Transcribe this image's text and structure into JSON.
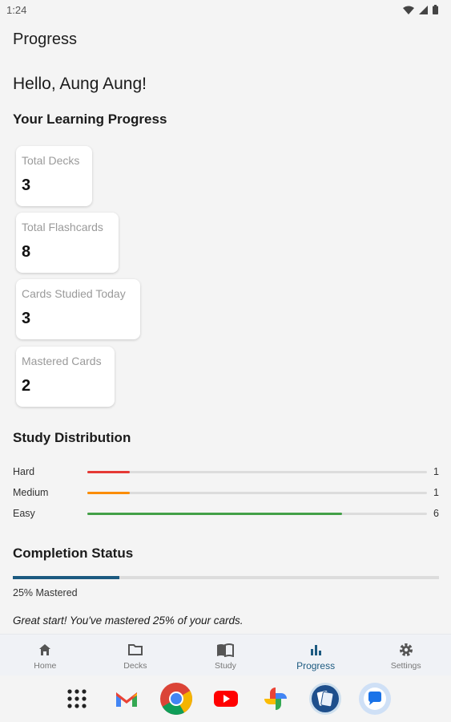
{
  "status_bar": {
    "time": "1:24",
    "icons": [
      "wifi-icon",
      "signal-icon",
      "battery-icon"
    ]
  },
  "app_bar": {
    "title": "Progress"
  },
  "greeting": "Hello, Aung Aung!",
  "learning_progress": {
    "title": "Your Learning Progress",
    "stats": [
      {
        "label": "Total Decks",
        "value": "3"
      },
      {
        "label": "Total Flashcards",
        "value": "8"
      },
      {
        "label": "Cards Studied Today",
        "value": "3"
      },
      {
        "label": "Mastered Cards",
        "value": "2"
      }
    ]
  },
  "study_distribution": {
    "title": "Study Distribution",
    "rows": [
      {
        "label": "Hard",
        "count": "1",
        "fraction": 0.125,
        "color": "#e53935"
      },
      {
        "label": "Medium",
        "count": "1",
        "fraction": 0.125,
        "color": "#fb8c00"
      },
      {
        "label": "Easy",
        "count": "6",
        "fraction": 0.75,
        "color": "#43a047"
      }
    ]
  },
  "completion": {
    "title": "Completion Status",
    "fraction": 0.25,
    "text": "25% Mastered",
    "message": "Great start! You've mastered 25% of your cards.",
    "color": "#1c5a80"
  },
  "bottom_nav": {
    "items": [
      {
        "label": "Home",
        "icon": "home-icon"
      },
      {
        "label": "Decks",
        "icon": "folder-icon"
      },
      {
        "label": "Study",
        "icon": "book-icon"
      },
      {
        "label": "Progress",
        "icon": "bar-chart-icon",
        "active": true
      },
      {
        "label": "Settings",
        "icon": "gear-icon"
      }
    ]
  },
  "dock": {
    "apps": [
      "app-drawer-icon",
      "gmail-icon",
      "chrome-icon",
      "youtube-icon",
      "photos-icon",
      "flashcards-app-icon",
      "messages-icon"
    ]
  }
}
